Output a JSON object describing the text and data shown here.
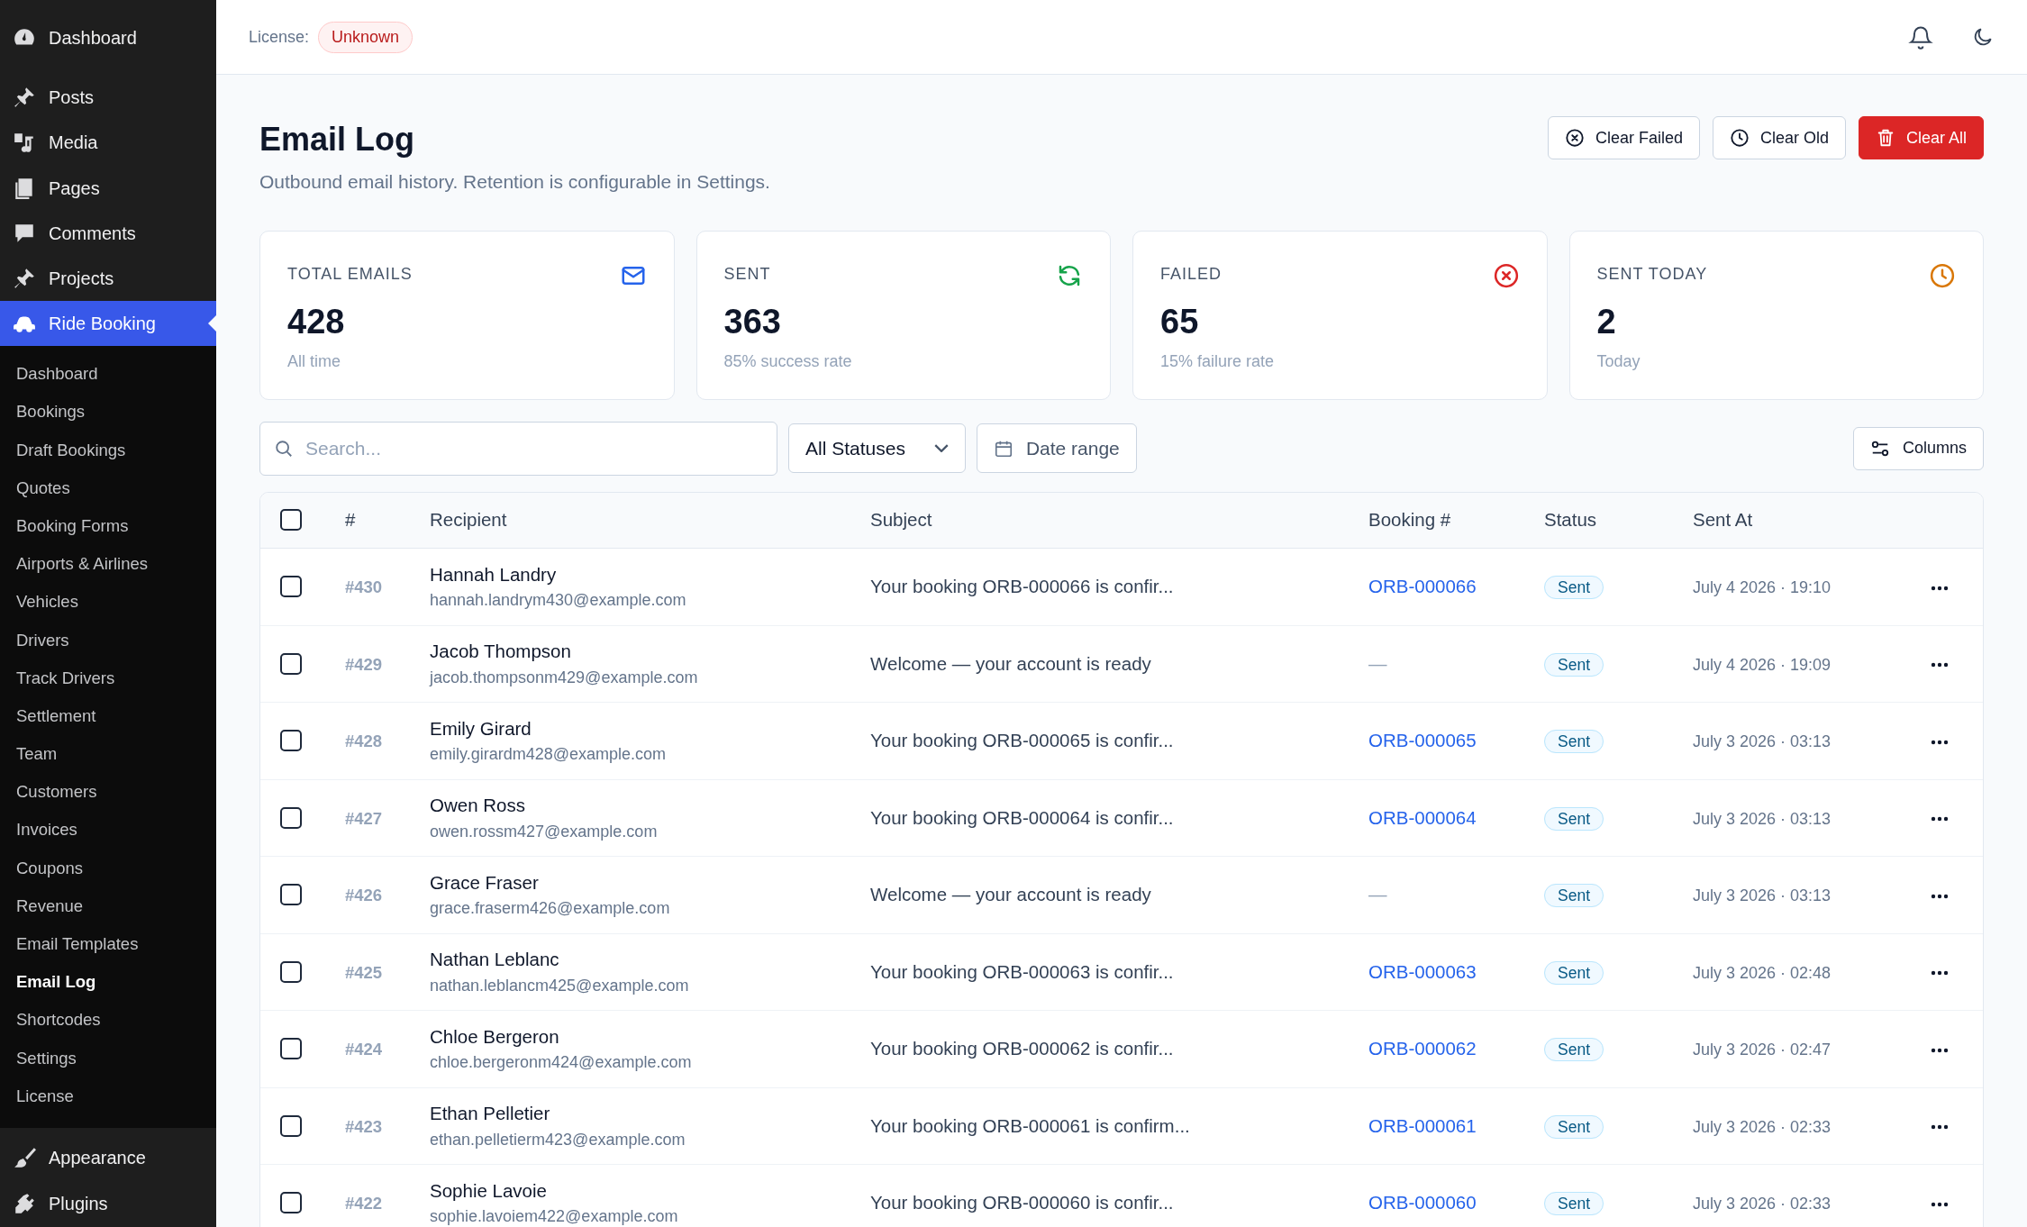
{
  "sidebar": {
    "menu": [
      {
        "label": "Dashboard",
        "kind": "gauge",
        "selected": false
      },
      {
        "label": "Posts",
        "kind": "pin",
        "selected": false
      },
      {
        "label": "Media",
        "kind": "media",
        "selected": false
      },
      {
        "label": "Pages",
        "kind": "pages",
        "selected": false
      },
      {
        "label": "Comments",
        "kind": "comment",
        "selected": false
      },
      {
        "label": "Projects",
        "kind": "pin",
        "selected": false
      },
      {
        "label": "Ride Booking",
        "kind": "car",
        "selected": true
      }
    ],
    "submenu": [
      {
        "label": "Dashboard",
        "selected": false
      },
      {
        "label": "Bookings",
        "selected": false
      },
      {
        "label": "Draft Bookings",
        "selected": false
      },
      {
        "label": "Quotes",
        "selected": false
      },
      {
        "label": "Booking Forms",
        "selected": false
      },
      {
        "label": "Airports & Airlines",
        "selected": false
      },
      {
        "label": "Vehicles",
        "selected": false
      },
      {
        "label": "Drivers",
        "selected": false
      },
      {
        "label": "Track Drivers",
        "selected": false
      },
      {
        "label": "Settlement",
        "selected": false
      },
      {
        "label": "Team",
        "selected": false
      },
      {
        "label": "Customers",
        "selected": false
      },
      {
        "label": "Invoices",
        "selected": false
      },
      {
        "label": "Coupons",
        "selected": false
      },
      {
        "label": "Revenue",
        "selected": false
      },
      {
        "label": "Email Templates",
        "selected": false
      },
      {
        "label": "Email Log",
        "selected": true
      },
      {
        "label": "Shortcodes",
        "selected": false
      },
      {
        "label": "Settings",
        "selected": false
      },
      {
        "label": "License",
        "selected": false
      }
    ],
    "menu_after": [
      {
        "label": "Appearance",
        "kind": "brush",
        "selected": false
      },
      {
        "label": "Plugins",
        "kind": "plug",
        "selected": false
      }
    ]
  },
  "topbar": {
    "license_label": "License:",
    "license_status": "Unknown"
  },
  "page": {
    "title": "Email Log",
    "subtitle": "Outbound email history. Retention is configurable in Settings.",
    "actions": [
      {
        "label": "Clear Failed",
        "kind": "outline"
      },
      {
        "label": "Clear Old",
        "kind": "outline"
      },
      {
        "label": "Clear All",
        "kind": "danger"
      }
    ]
  },
  "stats": [
    {
      "label": "TOTAL EMAILS",
      "value": "428",
      "note": "All time",
      "color": "#2563eb"
    },
    {
      "label": "SENT",
      "value": "363",
      "note": "85% success rate",
      "color": "#16a34a"
    },
    {
      "label": "FAILED",
      "value": "65",
      "note": "15% failure rate",
      "color": "#dc2626"
    },
    {
      "label": "SENT TODAY",
      "value": "2",
      "note": "Today",
      "color": "#d97706"
    }
  ],
  "filters": {
    "search": {
      "placeholder": "Search..."
    },
    "status": "All Statuses",
    "date": {
      "placeholder": "Date range"
    },
    "columns_button": "Columns"
  },
  "table": {
    "select_all": {
      "checked": false
    },
    "columns": [
      "#",
      "Recipient",
      "Subject",
      "Booking #",
      "Status",
      "Sent At"
    ],
    "rows": [
      {
        "checked": false,
        "id": "#430",
        "name": "Hannah Landry",
        "email": "hannah.landrym430@example.com",
        "subject": "Your booking ORB-000066 is confir...",
        "booking": "ORB-000066",
        "status": "Sent",
        "sent_at": "July 4 2026 · 19:10"
      },
      {
        "checked": false,
        "id": "#429",
        "name": "Jacob Thompson",
        "email": "jacob.thompsonm429@example.com",
        "subject": "Welcome — your account is ready",
        "booking": "—",
        "status": "Sent",
        "sent_at": "July 4 2026 · 19:09"
      },
      {
        "checked": false,
        "id": "#428",
        "name": "Emily Girard",
        "email": "emily.girardm428@example.com",
        "subject": "Your booking ORB-000065 is confir...",
        "booking": "ORB-000065",
        "status": "Sent",
        "sent_at": "July 3 2026 · 03:13"
      },
      {
        "checked": false,
        "id": "#427",
        "name": "Owen Ross",
        "email": "owen.rossm427@example.com",
        "subject": "Your booking ORB-000064 is confir...",
        "booking": "ORB-000064",
        "status": "Sent",
        "sent_at": "July 3 2026 · 03:13"
      },
      {
        "checked": false,
        "id": "#426",
        "name": "Grace Fraser",
        "email": "grace.fraserm426@example.com",
        "subject": "Welcome — your account is ready",
        "booking": "—",
        "status": "Sent",
        "sent_at": "July 3 2026 · 03:13"
      },
      {
        "checked": false,
        "id": "#425",
        "name": "Nathan Leblanc",
        "email": "nathan.leblancm425@example.com",
        "subject": "Your booking ORB-000063 is confir...",
        "booking": "ORB-000063",
        "status": "Sent",
        "sent_at": "July 3 2026 · 02:48"
      },
      {
        "checked": false,
        "id": "#424",
        "name": "Chloe Bergeron",
        "email": "chloe.bergeronm424@example.com",
        "subject": "Your booking ORB-000062 is confir...",
        "booking": "ORB-000062",
        "status": "Sent",
        "sent_at": "July 3 2026 · 02:47"
      },
      {
        "checked": false,
        "id": "#423",
        "name": "Ethan Pelletier",
        "email": "ethan.pelletierm423@example.com",
        "subject": "Your booking ORB-000061 is confirm...",
        "booking": "ORB-000061",
        "status": "Sent",
        "sent_at": "July 3 2026 · 02:33"
      },
      {
        "checked": false,
        "id": "#422",
        "name": "Sophie Lavoie",
        "email": "sophie.lavoiem422@example.com",
        "subject": "Your booking ORB-000060 is confir...",
        "booking": "ORB-000060",
        "status": "Sent",
        "sent_at": "July 3 2026 · 02:33"
      }
    ]
  }
}
